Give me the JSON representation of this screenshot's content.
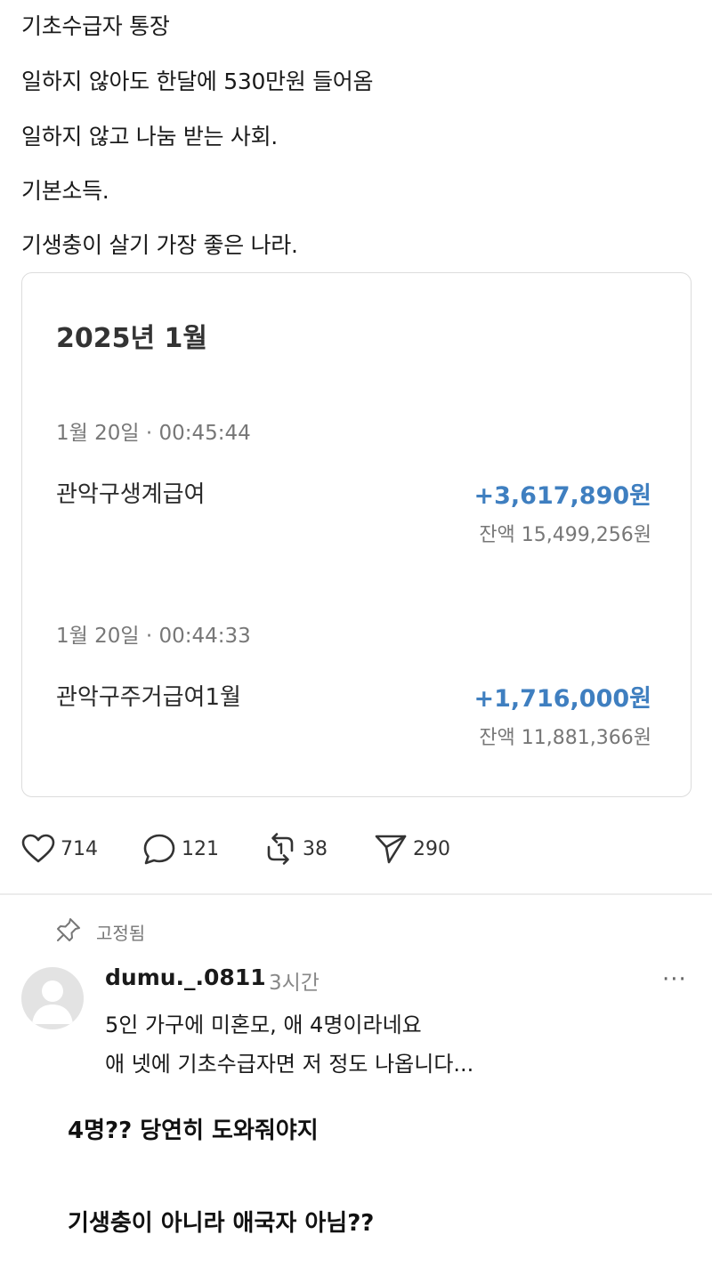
{
  "post": {
    "lines": [
      "기초수급자 통장",
      "일하지 않아도 한달에 530만원 들어옴",
      "일하지 않고 나눔 받는 사회.",
      "기본소득.",
      "기생충이 살기 가장 좋은 나라."
    ]
  },
  "card": {
    "month": "2025년 1월",
    "transactions": [
      {
        "date": "1월 20일 · 00:45:44",
        "title": "관악구생계급여",
        "amount": "+3,617,890원",
        "balance": "잔액 15,499,256원"
      },
      {
        "date": "1월 20일 · 00:44:33",
        "title": "관악구주거급여1월",
        "amount": "+1,716,000원",
        "balance": "잔액 11,881,366원"
      }
    ],
    "amount_color": "#3f7fc0"
  },
  "actions": {
    "likes": "714",
    "comments": "121",
    "reposts": "38",
    "shares": "290"
  },
  "pinned": {
    "label": "고정됨"
  },
  "comment": {
    "username": "dumu._.0811",
    "time": "3시간",
    "more": "···",
    "lines": [
      "5인 가구에 미혼모, 애 4명이라네요",
      "애 넷에 기초수급자면 저 정도 나옵니다..."
    ]
  },
  "replies": [
    "4명?? 당연히 도와줘야지",
    "기생충이 아니라 애국자 아님??"
  ]
}
